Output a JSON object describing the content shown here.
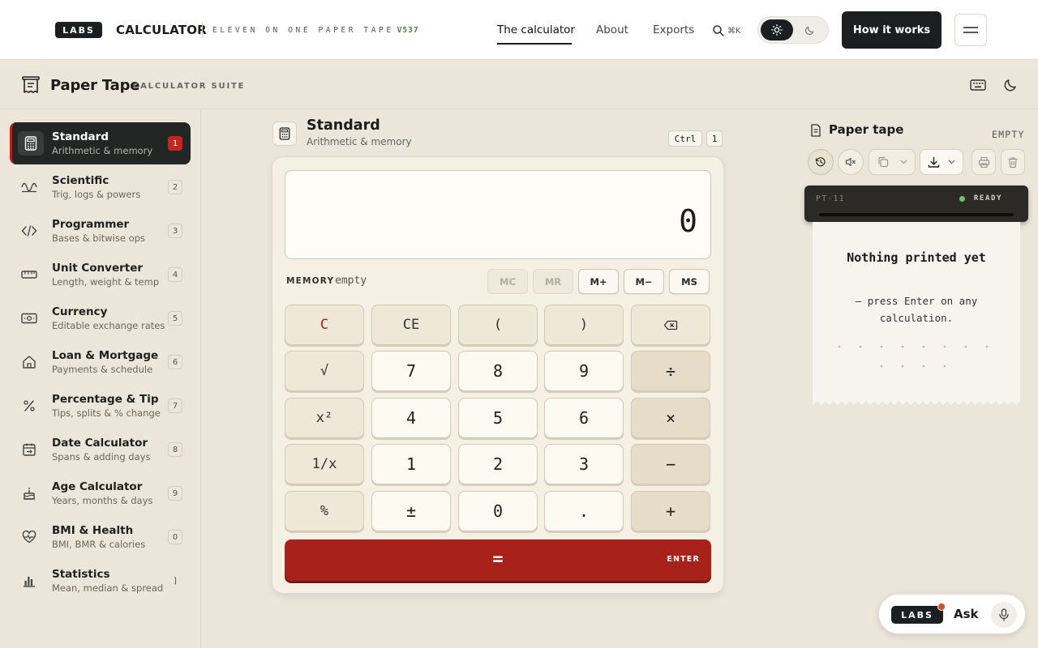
{
  "nav": {
    "logo": "LABS",
    "brand": "CALCULATOR",
    "tagline": "ELEVEN ON ONE PAPER TAPE",
    "version": "V537",
    "links": [
      "The calculator",
      "About",
      "Exports"
    ],
    "search_shortcut": "⌘K",
    "cta": "How it works"
  },
  "app": {
    "title": "Paper Tape",
    "subtitle": "CALCULATOR SUITE"
  },
  "sidebar": {
    "items": [
      {
        "title": "Standard",
        "desc": "Arithmetic & memory",
        "key": "1",
        "icon": "calculator-icon"
      },
      {
        "title": "Scientific",
        "desc": "Trig, logs & powers",
        "key": "2",
        "icon": "wave-icon"
      },
      {
        "title": "Programmer",
        "desc": "Bases & bitwise ops",
        "key": "3",
        "icon": "code-icon"
      },
      {
        "title": "Unit Converter",
        "desc": "Length, weight & temp",
        "key": "4",
        "icon": "ruler-icon"
      },
      {
        "title": "Currency",
        "desc": "Editable exchange rates",
        "key": "5",
        "icon": "banknote-icon"
      },
      {
        "title": "Loan & Mortgage",
        "desc": "Payments & schedule",
        "key": "6",
        "icon": "home-icon"
      },
      {
        "title": "Percentage & Tip",
        "desc": "Tips, splits & % change",
        "key": "7",
        "icon": "percent-icon"
      },
      {
        "title": "Date Calculator",
        "desc": "Spans & adding days",
        "key": "8",
        "icon": "calendar-icon"
      },
      {
        "title": "Age Calculator",
        "desc": "Years, months & days",
        "key": "9",
        "icon": "cake-icon"
      },
      {
        "title": "BMI & Health",
        "desc": "BMI, BMR & calories",
        "key": "0",
        "icon": "heart-pulse-icon"
      },
      {
        "title": "Statistics",
        "desc": "Mean, median & spread",
        "key": "]",
        "icon": "bar-chart-icon"
      }
    ]
  },
  "calc": {
    "title": "Standard",
    "subtitle": "Arithmetic & memory",
    "shortcut": [
      "Ctrl",
      "1"
    ],
    "display": "0",
    "memory_label": "MEMORY",
    "memory_value": "empty",
    "memory_buttons": [
      {
        "label": "MC",
        "enabled": false
      },
      {
        "label": "MR",
        "enabled": false
      },
      {
        "label": "M+",
        "enabled": true
      },
      {
        "label": "M−",
        "enabled": true
      },
      {
        "label": "MS",
        "enabled": true
      }
    ],
    "keys": [
      [
        "C",
        "CE",
        "(",
        ")",
        "⌫"
      ],
      [
        "√",
        "7",
        "8",
        "9",
        "÷"
      ],
      [
        "x²",
        "4",
        "5",
        "6",
        "×"
      ],
      [
        "1/x",
        "1",
        "2",
        "3",
        "−"
      ],
      [
        "%",
        "±",
        "0",
        ".",
        "+"
      ]
    ],
    "equals": "=",
    "equals_hint": "ENTER"
  },
  "tape": {
    "title": "Paper tape",
    "status": "EMPTY",
    "printer_model": "PT-11",
    "printer_status": "READY",
    "empty_title": "Nothing printed yet",
    "empty_text": "— press Enter on any calculation."
  },
  "ask": {
    "logo": "LABS",
    "label": "Ask"
  },
  "colors": {
    "accent_red": "#a8221b",
    "ready_green": "#6fc069",
    "dark": "#1c1f21"
  }
}
